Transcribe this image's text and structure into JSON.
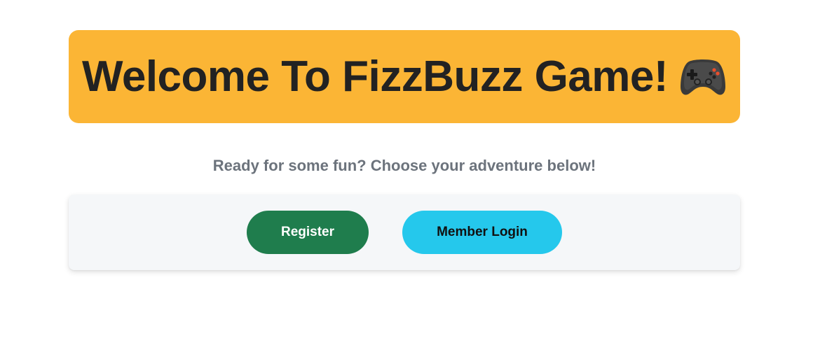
{
  "header": {
    "title": "Welcome To FizzBuzz Game!",
    "icon": "gamepad-icon",
    "background_color": "#fbb535"
  },
  "intro": {
    "text": "Ready for some fun? Choose your adventure below!"
  },
  "actions": {
    "register_label": "Register",
    "register_color": "#1f7d4d",
    "login_label": "Member Login",
    "login_color": "#25c8ec"
  }
}
